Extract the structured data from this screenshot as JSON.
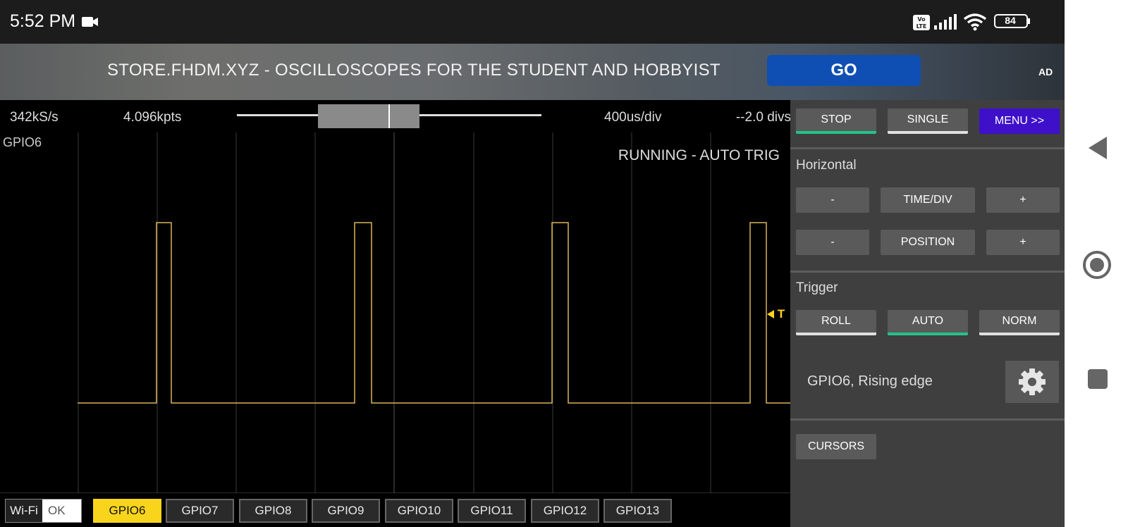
{
  "status_bar": {
    "time": "5:52 PM",
    "camera_icon": "video-camera-icon",
    "network_badge": "VoLTE",
    "battery": "84"
  },
  "ad": {
    "text": "STORE.FHDM.XYZ - OSCILLOSCOPES FOR THE STUDENT AND HOBBYIST",
    "button": "GO",
    "tag": "AD"
  },
  "scope": {
    "sample_rate": "342kS/s",
    "points": "4.096kpts",
    "time_div": "400us/div",
    "position": "--2.0 divs",
    "channel_label": "GPIO6",
    "run_status": "RUNNING - AUTO TRIG",
    "trigger_marker": "T",
    "buffer_view_fraction": 0.33,
    "trace_color": "#d9b55a"
  },
  "bottom": {
    "wifi_label": "Wi-Fi",
    "wifi_status": "OK",
    "channels": [
      "GPIO6",
      "GPIO7",
      "GPIO8",
      "GPIO9",
      "GPIO10",
      "GPIO11",
      "GPIO12",
      "GPIO13"
    ],
    "active_channel": "GPIO6",
    "active_color": "#f8d51c"
  },
  "panel": {
    "stop": "STOP",
    "single": "SINGLE",
    "menu": "MENU >>",
    "horizontal_title": "Horizontal",
    "minus": "-",
    "plus": "+",
    "time_div": "TIME/DIV",
    "position": "POSITION",
    "trigger_title": "Trigger",
    "roll": "ROLL",
    "auto": "AUTO",
    "norm": "NORM",
    "trigger_source": "GPIO6, Rising edge",
    "cursors": "CURSORS",
    "accent_color": "#22c38b",
    "menu_color": "#3e10c9"
  },
  "nav": {
    "back": "back-triangle-icon",
    "home": "home-circle-icon",
    "recents": "recents-square-icon"
  }
}
